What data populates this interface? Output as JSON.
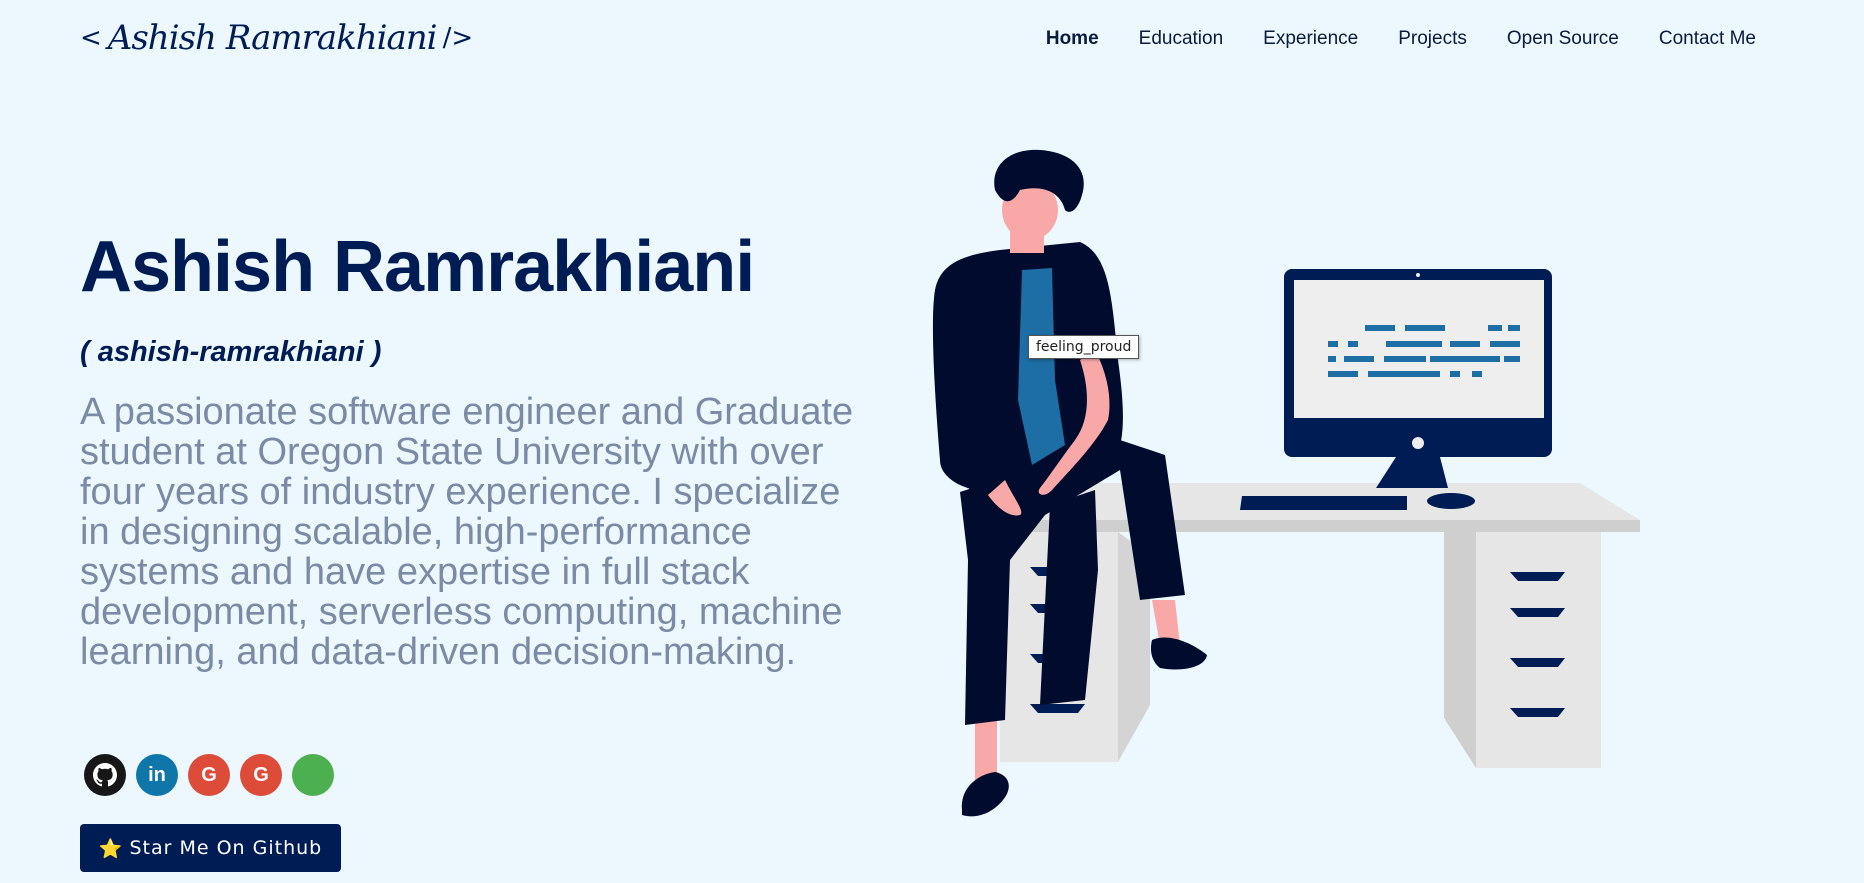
{
  "header": {
    "logo_open": "< ",
    "logo_text": "Ashish Ramrakhiani",
    "logo_close": " />",
    "nav": [
      {
        "label": "Home",
        "active": true
      },
      {
        "label": "Education"
      },
      {
        "label": "Experience"
      },
      {
        "label": "Projects"
      },
      {
        "label": "Open Source"
      },
      {
        "label": "Contact Me"
      }
    ]
  },
  "hero": {
    "name": "Ashish Ramrakhiani",
    "handle": "( ashish-ramrakhiani )",
    "bio": "A passionate software engineer and Graduate student at Oregon State University with over four years of industry experience. I specialize in designing scalable, high-performance systems and have expertise in full stack development, serverless computing, machine learning, and data-driven decision-making.",
    "socials": [
      {
        "icon": "github-icon",
        "color": "#181717"
      },
      {
        "icon": "linkedin-icon",
        "color": "#0e76a8",
        "glyph": "in"
      },
      {
        "icon": "google-icon",
        "color": "#dd4b39",
        "glyph": "G"
      },
      {
        "icon": "google-icon",
        "color": "#dd4b39",
        "glyph": "G"
      },
      {
        "icon": "blank-circle-icon",
        "color": "#4caf50",
        "glyph": ""
      }
    ],
    "star_button": "Star Me On Github",
    "star_icon": "⭐"
  },
  "illustration": {
    "tooltip": "feeling_proud"
  },
  "colors": {
    "background": "#ecf8fd",
    "primary": "#001c55",
    "bio_text": "#7c8aa6"
  }
}
